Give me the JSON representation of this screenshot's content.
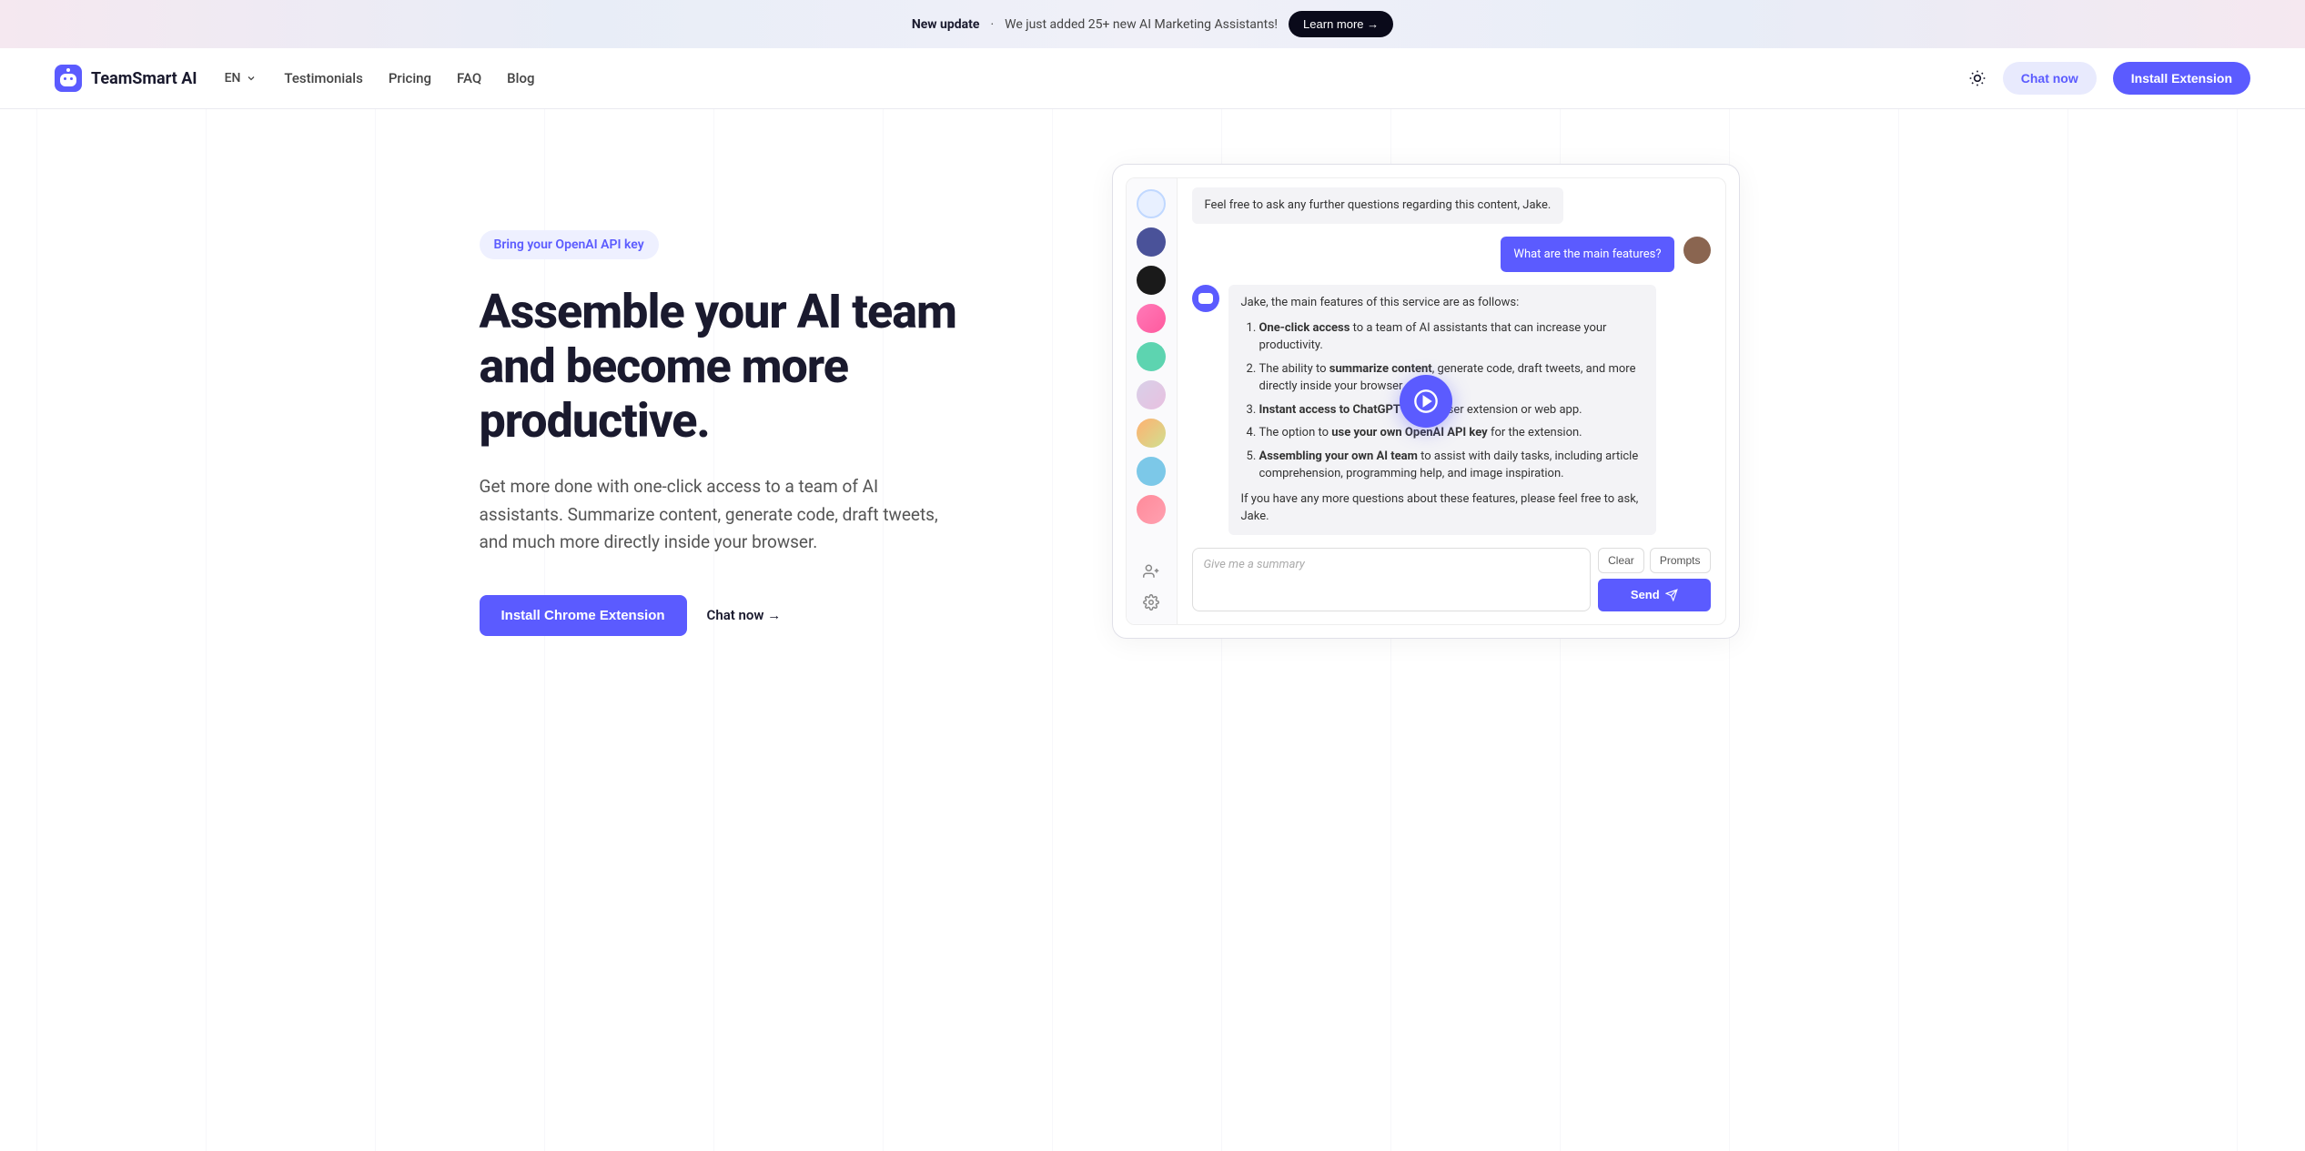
{
  "banner": {
    "bold_text": "New update",
    "separator": "·",
    "message": "We just added 25+ new AI Marketing Assistants!",
    "cta": "Learn more →"
  },
  "nav": {
    "brand": "TeamSmart AI",
    "lang": "EN",
    "links": {
      "testimonials": "Testimonials",
      "pricing": "Pricing",
      "faq": "FAQ",
      "blog": "Blog"
    },
    "chat_now": "Chat now",
    "install": "Install Extension"
  },
  "hero": {
    "badge": "Bring your OpenAI API key",
    "title": "Assemble your AI team and become more productive.",
    "subtitle": "Get more done with one-click access to a team of AI assistants. Summarize content, generate code, draft tweets, and much more directly inside your browser.",
    "install_cta": "Install Chrome Extension",
    "chat_cta": "Chat now →"
  },
  "chat": {
    "msg1": "Feel free to ask any further questions regarding this content, Jake.",
    "user_msg": "What are the main features?",
    "msg2_intro": "Jake, the main features of this service are as follows:",
    "features": [
      {
        "bold": "One-click access",
        "rest": " to a team of AI assistants that can increase your productivity."
      },
      {
        "pre": "The ability to ",
        "bold": "summarize content",
        "rest": ", generate code, draft tweets, and more directly inside your browser."
      },
      {
        "bold": "Instant access to ChatGPT",
        "rest": " via browser extension or web app."
      },
      {
        "pre": "The option to ",
        "bold": "use your own OpenAI API key",
        "rest": " for the extension."
      },
      {
        "bold": "Assembling your own AI team",
        "rest": " to assist with daily tasks, including article comprehension, programming help, and image inspiration."
      }
    ],
    "msg2_outro": "If you have any more questions about these features, please feel free to ask, Jake.",
    "input_placeholder": "Give me a summary",
    "clear": "Clear",
    "prompts": "Prompts",
    "send": "Send"
  },
  "sidebar_avatars": [
    {
      "bg": "#e8f0ff",
      "name": "assistant-1"
    },
    {
      "bg": "#4a5299",
      "name": "assistant-2"
    },
    {
      "bg": "#1a1a1a",
      "name": "assistant-3"
    },
    {
      "bg": "#ff7ab8",
      "name": "assistant-4"
    },
    {
      "bg": "#5dd4b0",
      "name": "assistant-5"
    },
    {
      "bg": "#d8d0e8",
      "name": "assistant-6"
    },
    {
      "bg": "#ffb070",
      "name": "assistant-7"
    },
    {
      "bg": "#7cc8e8",
      "name": "assistant-8"
    },
    {
      "bg": "#ff8a9a",
      "name": "assistant-9"
    }
  ]
}
